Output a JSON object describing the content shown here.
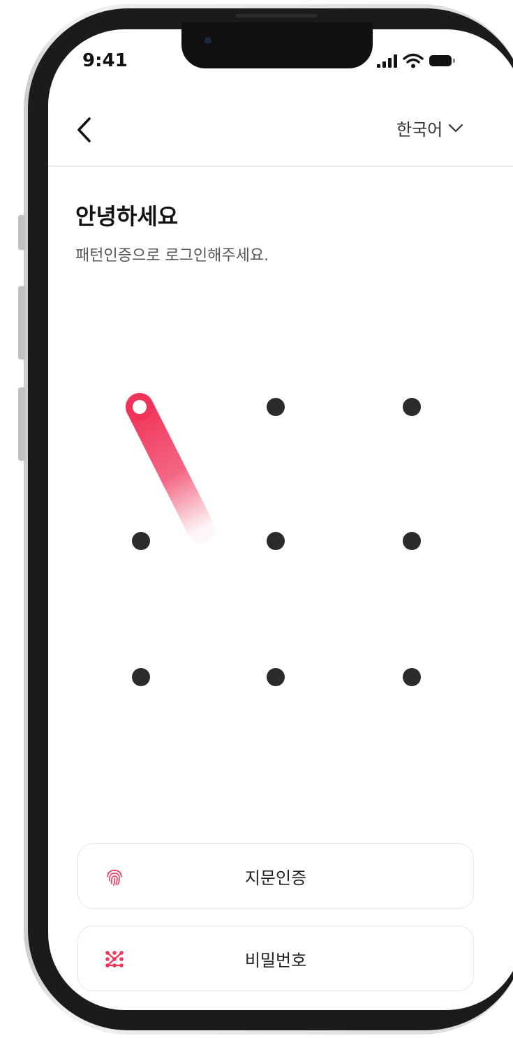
{
  "status_bar": {
    "time": "9:41"
  },
  "header": {
    "language_label": "한국어"
  },
  "main": {
    "title": "안녕하세요",
    "subtitle": "패턴인증으로 로그인해주세요."
  },
  "pattern": {
    "rows": 3,
    "cols": 3,
    "active_dot": 1,
    "accent_color": "#f0345a",
    "dot_color": "#2b2b2b"
  },
  "auth_options": [
    {
      "label": "지문인증",
      "icon": "fingerprint-icon"
    },
    {
      "label": "비밀번호",
      "icon": "password-icon"
    }
  ],
  "colors": {
    "accent": "#f0345a",
    "text": "#111111",
    "muted": "#555555"
  }
}
